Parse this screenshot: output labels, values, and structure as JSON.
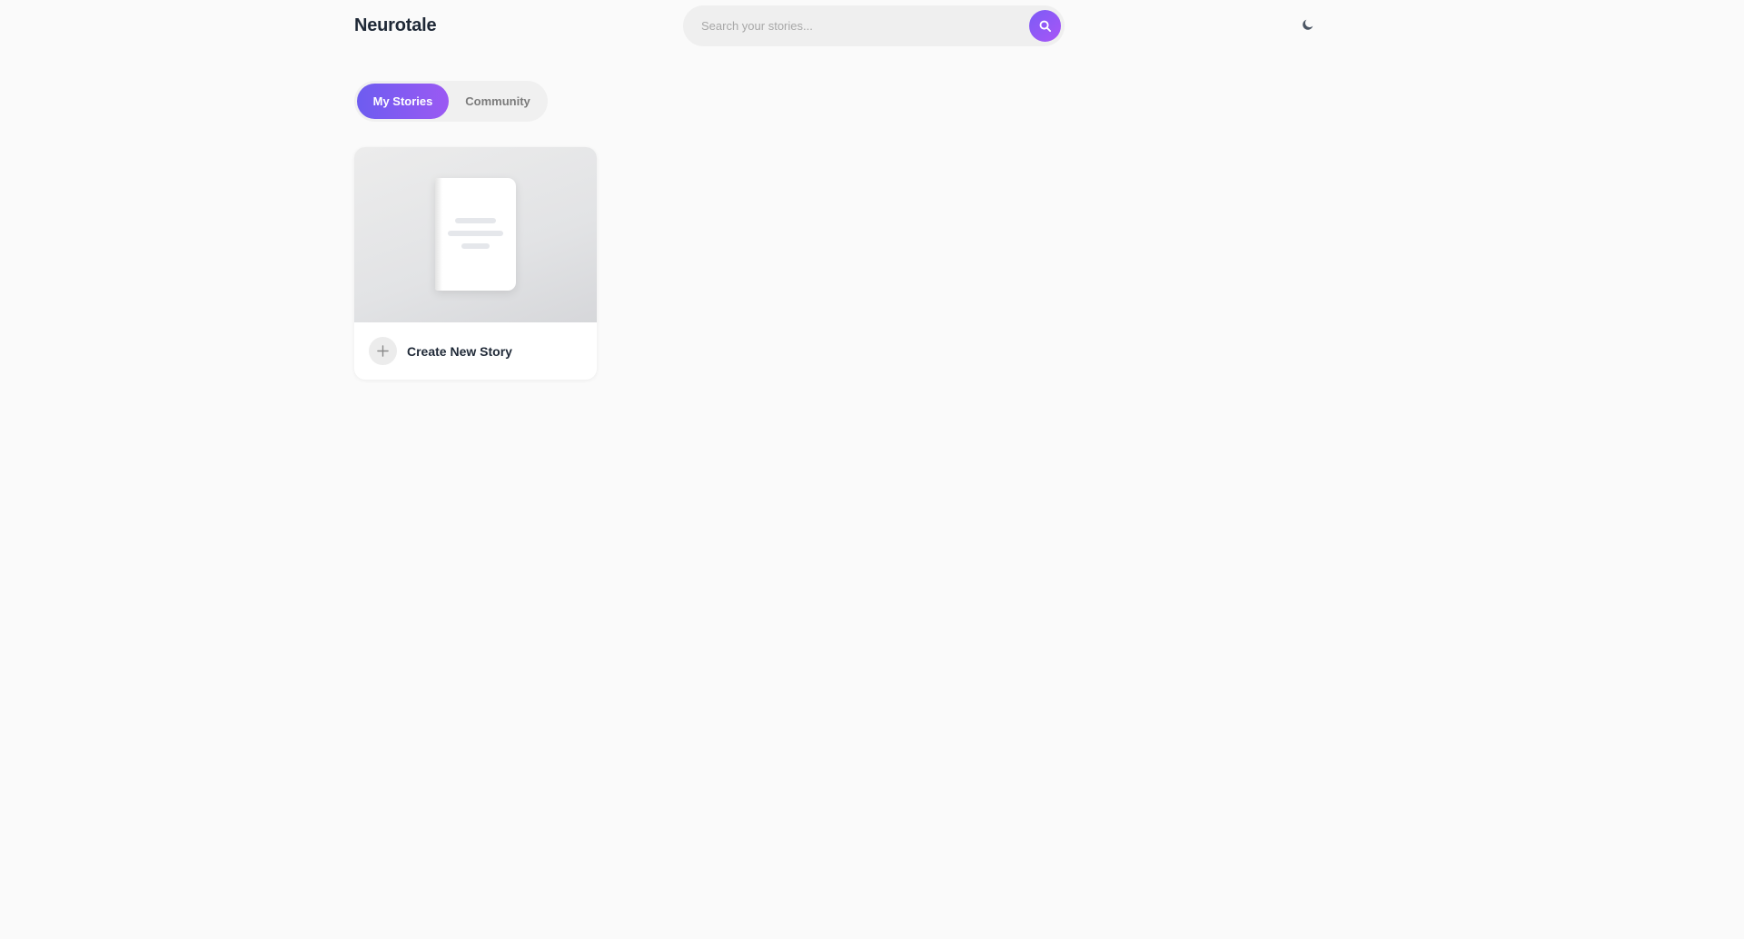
{
  "app": {
    "name": "Neurotale"
  },
  "search": {
    "placeholder": "Search your stories...",
    "button_icon": "search-icon"
  },
  "header": {
    "theme_toggle_icon": "moon-icon"
  },
  "tabs": [
    {
      "label": "My Stories",
      "active": true
    },
    {
      "label": "Community",
      "active": false
    }
  ],
  "stories": {
    "create_card": {
      "label": "Create New Story",
      "icon": "plus-icon",
      "cover_icon": "book-icon"
    }
  },
  "colors": {
    "accent_start": "#6d5cf0",
    "accent_end": "#a855f7",
    "background": "#fafafa",
    "text": "#1f2937"
  }
}
